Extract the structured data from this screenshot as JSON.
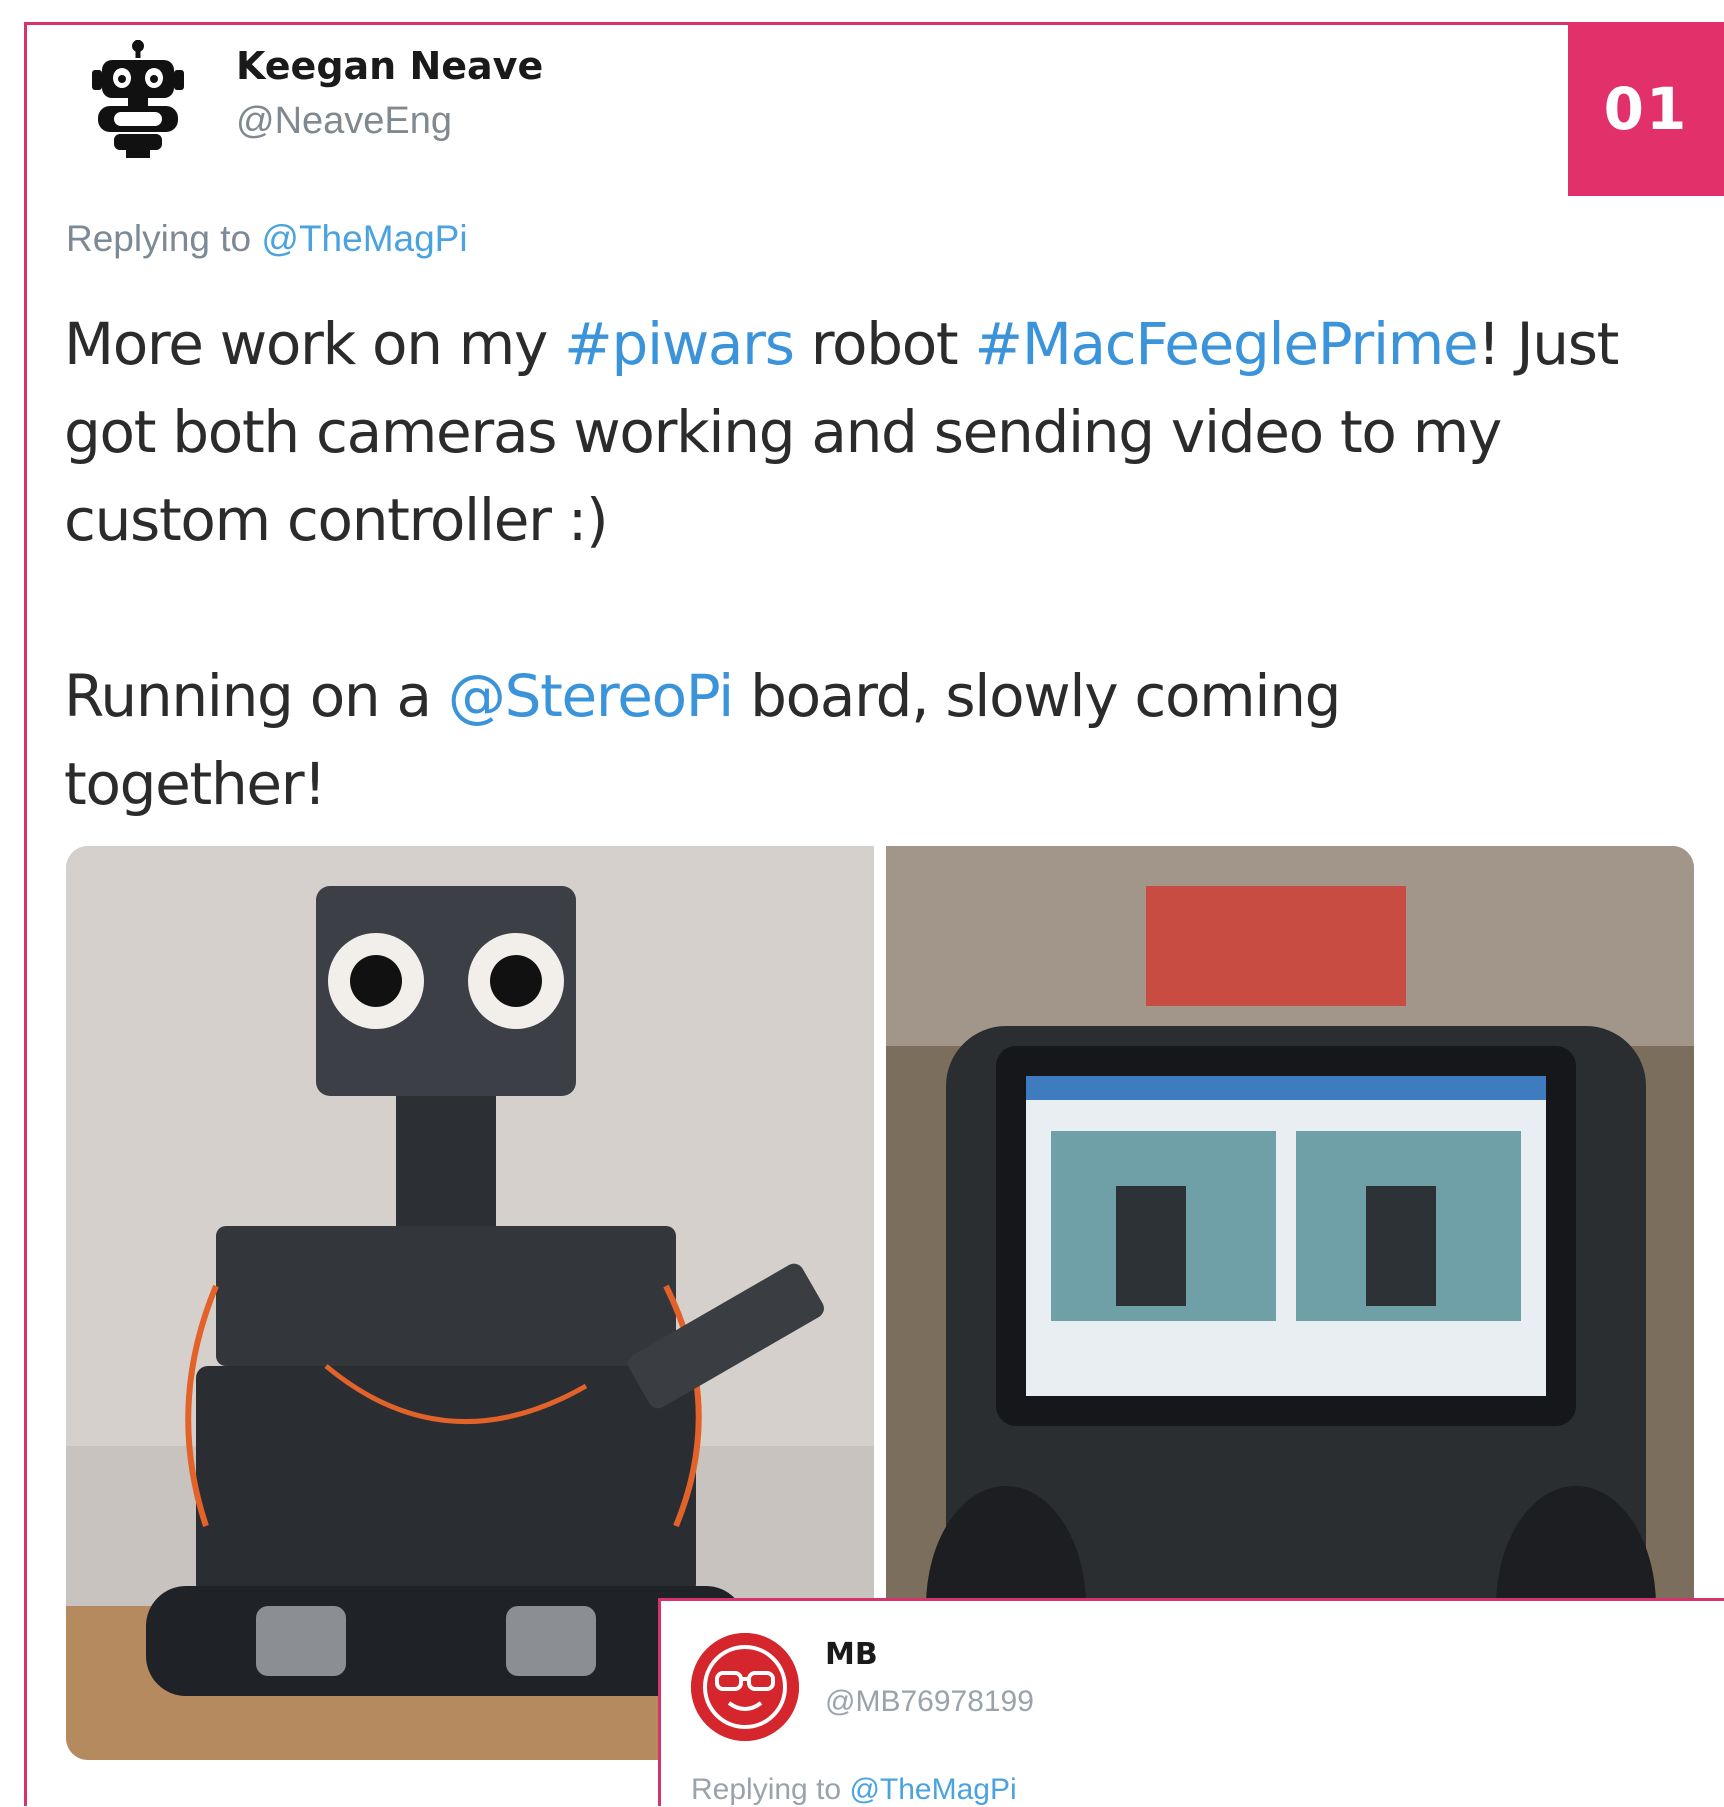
{
  "badge": {
    "number": "01"
  },
  "tweet": {
    "author": {
      "name": "Keegan Neave",
      "handle": "@NeaveEng",
      "avatar_icon": "robot-icon"
    },
    "replying_prefix": "Replying to ",
    "replying_to": "@TheMagPi",
    "line1": {
      "a": "More work on my ",
      "hashtag1": "#piwars",
      "b": " robot ",
      "hashtag2": "#MacFeeglePrime",
      "c": "! Just"
    },
    "line2": "got both cameras working and sending video to my",
    "line3": "custom controller :)",
    "line4": {
      "a": "Running on a ",
      "mention": "@StereoPi",
      "b": " board, slowly coming"
    },
    "line5": "together!",
    "media": [
      {
        "icon": "robot-photo"
      },
      {
        "icon": "controller-photo"
      }
    ]
  },
  "reply": {
    "author": {
      "name": "MB",
      "handle": "@MB76978199",
      "avatar_icon": "glasses-face-icon"
    },
    "replying_prefix": "Replying to ",
    "replying_to": "@TheMagPi"
  },
  "colors": {
    "accent": "#e2306b",
    "link": "#3b94d9",
    "border": "#d6336c"
  }
}
